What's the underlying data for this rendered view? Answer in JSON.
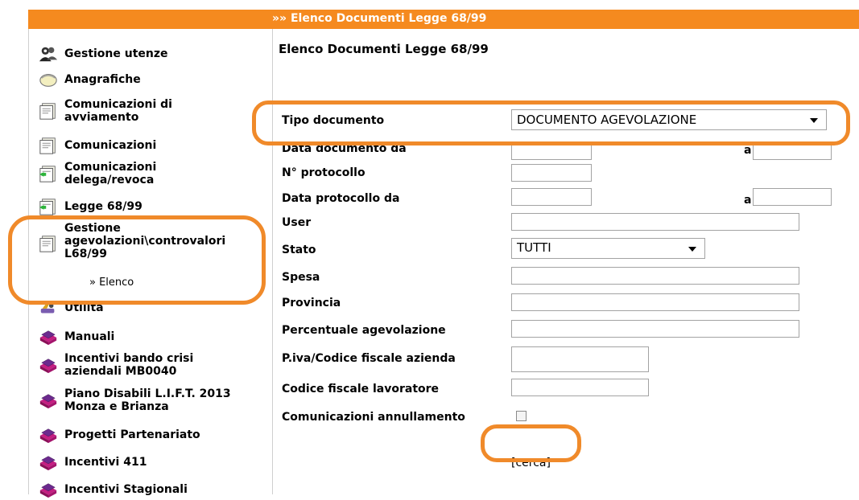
{
  "header": {
    "title": "»» Elenco Documenti Legge 68/99"
  },
  "sidebar": {
    "items": [
      {
        "label": "Gestione utenze",
        "icon": "users-icon"
      },
      {
        "label": "Anagrafiche",
        "icon": "folder-icon"
      },
      {
        "label": "Comunicazioni di avviamento",
        "icon": "document-icon"
      },
      {
        "label": "Comunicazioni",
        "icon": "document-icon"
      },
      {
        "label": "Comunicazioni delega/revoca",
        "icon": "document-green-icon"
      },
      {
        "label": "Legge 68/99",
        "icon": "document-green-icon"
      },
      {
        "label": "Gestione agevolazioni\\controvalori L68/99",
        "icon": "document-icon"
      },
      {
        "label": "Utilità",
        "icon": "tools-icon"
      },
      {
        "label": "Manuali",
        "icon": "books-icon"
      },
      {
        "label": "Incentivi bando crisi aziendali MB0040",
        "icon": "books-icon"
      },
      {
        "label": "Piano Disabili L.I.F.T. 2013 Monza e Brianza",
        "icon": "books-icon"
      },
      {
        "label": "Progetti Partenariato",
        "icon": "books-icon"
      },
      {
        "label": "Incentivi 411",
        "icon": "books-icon"
      },
      {
        "label": "Incentivi Stagionali",
        "icon": "books-icon"
      }
    ],
    "subitem": "» Elenco"
  },
  "main": {
    "heading": "Elenco Documenti Legge 68/99",
    "fields": {
      "tipo_documento": {
        "label": "Tipo documento",
        "value": "DOCUMENTO AGEVOLAZIONE"
      },
      "data_documento": {
        "label": "Data documento da",
        "a": "a"
      },
      "protocollo": {
        "label": "N° protocollo"
      },
      "data_protocollo": {
        "label": "Data protocollo da",
        "a": "a"
      },
      "user": {
        "label": "User"
      },
      "stato": {
        "label": "Stato",
        "value": "TUTTI"
      },
      "spesa": {
        "label": "Spesa"
      },
      "provincia": {
        "label": "Provincia"
      },
      "percentuale": {
        "label": "Percentuale agevolazione"
      },
      "piva": {
        "label": "P.iva/Codice fiscale azienda"
      },
      "cf_lavoratore": {
        "label": "Codice fiscale lavoratore"
      },
      "annullamento": {
        "label": "Comunicazioni annullamento"
      }
    },
    "search_label": "[cerca]"
  },
  "colors": {
    "accent": "#f58a1f",
    "highlight": "#f08a2a"
  }
}
